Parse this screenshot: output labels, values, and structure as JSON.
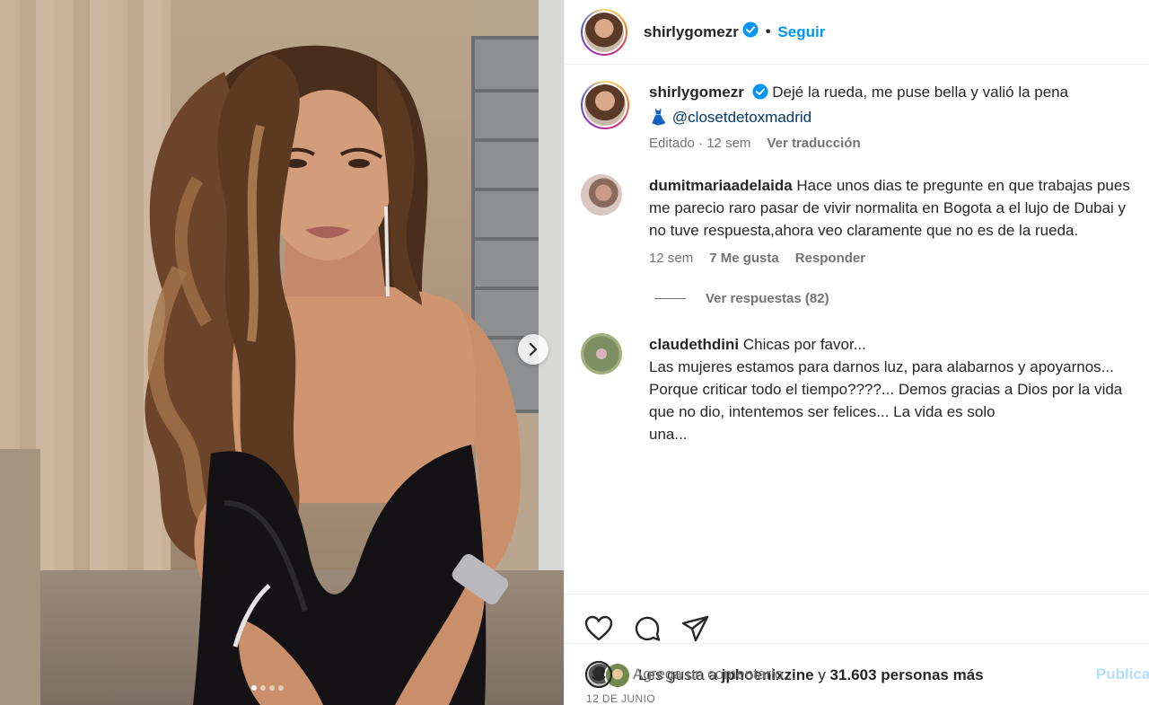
{
  "post": {
    "author": "shirlygomezr",
    "follow_label": "Seguir",
    "separator": "•",
    "caption": {
      "text": "Dejé la rueda, me puse bella y valió la pena",
      "emoji": "👗",
      "mention": "@closetdetoxmadrid",
      "edited_label": "Editado",
      "time": "12 sem",
      "translate_label": "Ver traducción"
    },
    "carousel": {
      "slides": 4,
      "active": 1
    }
  },
  "comments": [
    {
      "user": "dumitmariaadelaida",
      "text": "Hace unos dias te pregunte en que trabajas pues me parecio raro pasar de vivir normalita en Bogota a el lujo de Dubai y no tuve respuesta,ahora veo claramente que no es de la rueda.",
      "time": "12 sem",
      "likes": "7 Me gusta",
      "reply_label": "Responder",
      "view_replies": "Ver respuestas (82)"
    },
    {
      "user": "claudethdini",
      "lines": [
        "Chicas por favor...",
        "Las mujeres estamos para darnos luz, para alabarnos y apoyarnos...",
        "Porque criticar todo el tiempo????... Demos gracias a Dios por la vida que no dio, intentemos ser felices... La vida es solo",
        "una..."
      ]
    }
  ],
  "likes": {
    "prefix": "Les gusta a ",
    "user": "jphoenixzine",
    "middle": " y ",
    "count": "31.603 personas más"
  },
  "date": "12 DE JUNIO",
  "add_comment": {
    "placeholder": "Agrega un comentario...",
    "publish": "Publicar"
  },
  "colors": {
    "accent": "#0095f6",
    "verified": "#0095f6",
    "mention": "#00376b",
    "muted": "#737373"
  }
}
